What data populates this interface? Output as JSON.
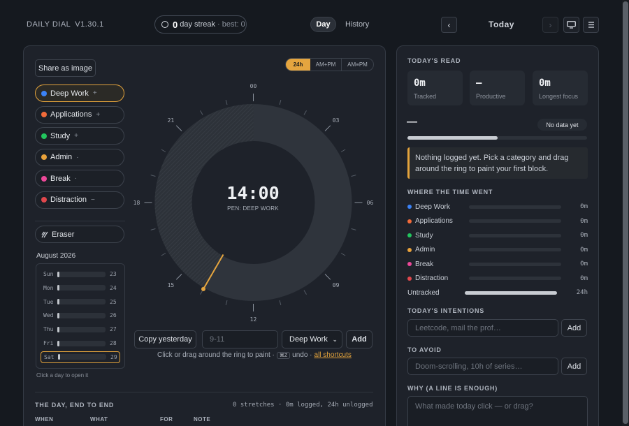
{
  "header": {
    "brand": "DAILY DIAL",
    "version": "V1.30.1",
    "streak_num": "0",
    "streak_label": "day streak",
    "streak_best": "· best: 0",
    "tab_day": "Day",
    "tab_history": "History",
    "prev": "‹",
    "next": "›",
    "today": "Today",
    "monitor_icon": "monitor-icon",
    "menu_icon": "hamburger-menu-icon"
  },
  "left": {
    "share": "Share as image",
    "formats": [
      "24h",
      "AM+PM",
      "AM≡PM"
    ],
    "categories": [
      {
        "label": "Deep Work",
        "sym": "+",
        "color": "#3b82f6"
      },
      {
        "label": "Applications",
        "sym": "+",
        "color": "#f26b3a"
      },
      {
        "label": "Study",
        "sym": "+",
        "color": "#22c55e"
      },
      {
        "label": "Admin",
        "sym": "·",
        "color": "#e9a23b"
      },
      {
        "label": "Break",
        "sym": "·",
        "color": "#ec4899"
      },
      {
        "label": "Distraction",
        "sym": "−",
        "color": "#e0474c"
      }
    ],
    "eraser": "Eraser",
    "month": "August 2026",
    "days": [
      {
        "name": "Sun",
        "num": "23"
      },
      {
        "name": "Mon",
        "num": "24"
      },
      {
        "name": "Tue",
        "num": "25"
      },
      {
        "name": "Wed",
        "num": "26"
      },
      {
        "name": "Thu",
        "num": "27"
      },
      {
        "name": "Fri",
        "num": "28"
      },
      {
        "name": "Sat",
        "num": "29"
      }
    ],
    "cal_hint": "Click a day to open it"
  },
  "dial": {
    "time": "14:00",
    "pen": "PEN: DEEP WORK",
    "hour_labels": [
      "00",
      "03",
      "06",
      "09",
      "12",
      "15",
      "18",
      "21"
    ],
    "current_hour": 14
  },
  "controls": {
    "copy": "Copy yesterday",
    "range_placeholder": "9-11",
    "category_selected": "Deep Work",
    "add": "Add",
    "hint_prefix": "Click or drag around the ring to paint ·",
    "kbd": "⌘Z",
    "hint_undo": "undo ·",
    "shortcuts": "all shortcuts"
  },
  "table": {
    "title": "THE DAY, END TO END",
    "summary": "0 stretches · 0m logged, 24h unlogged",
    "headers": [
      "WHEN",
      "WHAT",
      "FOR",
      "NOTE"
    ]
  },
  "right": {
    "read_title": "TODAY'S READ",
    "stats": [
      {
        "value": "0m",
        "label": "Tracked"
      },
      {
        "value": "—",
        "label": "Productive"
      },
      {
        "value": "0m",
        "label": "Longest focus"
      }
    ],
    "score": "—",
    "no_data": "No data yet",
    "notice": "Nothing logged yet. Pick a category and drag around the ring to paint your first block.",
    "where_title": "WHERE THE TIME WENT",
    "breakdown": [
      {
        "label": "Deep Work",
        "value": "0m",
        "color": "#3b82f6",
        "fraction": 0
      },
      {
        "label": "Applications",
        "value": "0m",
        "color": "#f26b3a",
        "fraction": 0
      },
      {
        "label": "Study",
        "value": "0m",
        "color": "#22c55e",
        "fraction": 0
      },
      {
        "label": "Admin",
        "value": "0m",
        "color": "#e9a23b",
        "fraction": 0
      },
      {
        "label": "Break",
        "value": "0m",
        "color": "#ec4899",
        "fraction": 0
      },
      {
        "label": "Distraction",
        "value": "0m",
        "color": "#e0474c",
        "fraction": 0
      },
      {
        "label": "Untracked",
        "value": "24h",
        "color": "",
        "fraction": 1
      }
    ],
    "intentions_title": "TODAY'S INTENTIONS",
    "intentions_placeholder": "Leetcode, mail the prof…",
    "intentions_add": "Add",
    "avoid_title": "TO AVOID",
    "avoid_placeholder": "Doom-scrolling, 10h of series…",
    "avoid_add": "Add",
    "why_title": "WHY (A LINE IS ENOUGH)",
    "why_placeholder": "What made today click — or drag?"
  }
}
